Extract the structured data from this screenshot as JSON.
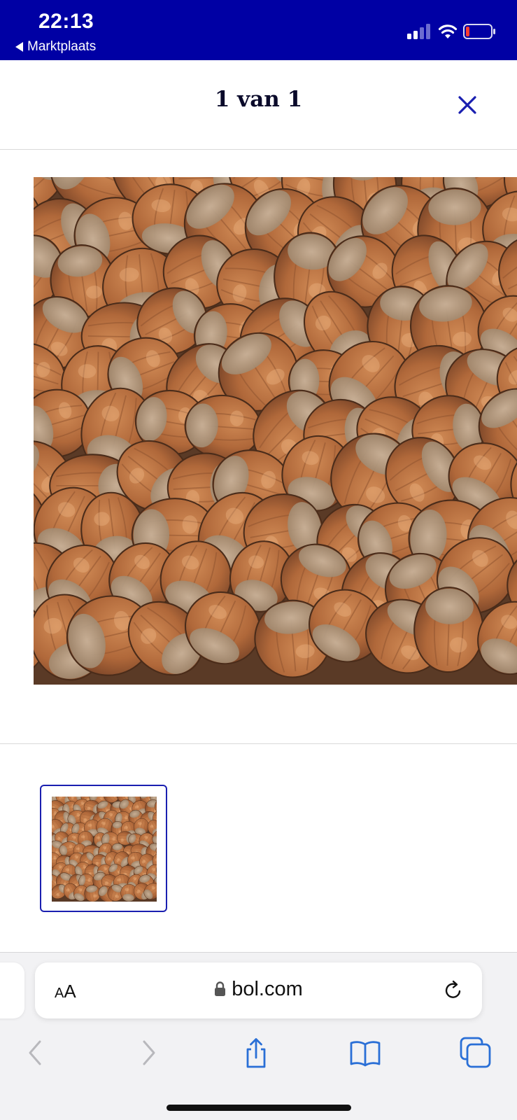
{
  "status_bar": {
    "time": "22:13",
    "back_app": "Marktplaats",
    "icons": [
      "cellular-signal-icon",
      "wifi-icon",
      "battery-low-icon"
    ]
  },
  "header": {
    "title": "1 van 1",
    "close_icon": "close-icon"
  },
  "gallery": {
    "main_image": "hazelnuts-photo",
    "thumbnails": [
      {
        "image": "hazelnuts-thumbnail",
        "selected": true
      }
    ]
  },
  "browser": {
    "text_size_label_big": "A",
    "text_size_label_small": "A",
    "url": "bol.com",
    "toolbar_icons": [
      "back-arrow-icon",
      "forward-arrow-icon",
      "share-icon",
      "bookmarks-icon",
      "tabs-icon"
    ]
  },
  "colors": {
    "status_bar_bg": "#0000a4",
    "accent": "#1a1fb0",
    "toolbar_icon": "#2a6fd6",
    "toolbar_icon_disabled": "#b8b8bc"
  }
}
